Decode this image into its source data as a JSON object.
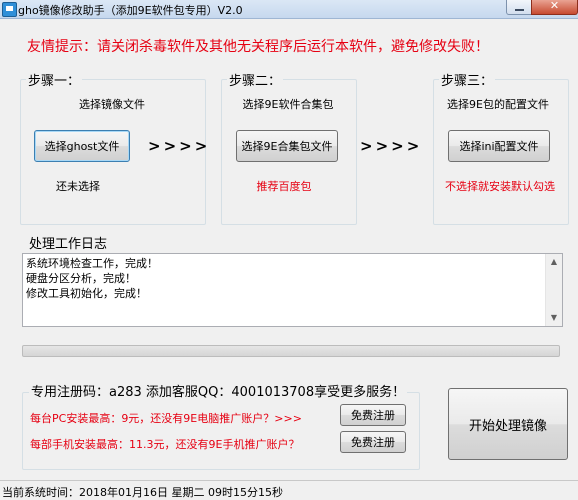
{
  "window": {
    "title": "gho镜像修改助手（添加9E软件包专用）V2.0"
  },
  "notice": "友情提示：请关闭杀毒软件及其他无关程序后运行本软件，避免修改失败！",
  "steps": [
    {
      "title": "步骤一：",
      "desc": "选择镜像文件",
      "button": "选择ghost文件",
      "status": "还未选择",
      "status_color": "#000000"
    },
    {
      "title": "步骤二：",
      "desc": "选择9E软件合集包",
      "button": "选择9E合集包文件",
      "status": "推荐百度包",
      "status_color": "#e60012"
    },
    {
      "title": "步骤三：",
      "desc": "选择9E包的配置文件",
      "button": "选择ini配置文件",
      "status": "不选择就安装默认勾选",
      "status_color": "#e60012"
    }
  ],
  "arrows": ">>>>",
  "log": {
    "title": "处理工作日志",
    "lines": [
      "系统环境检查工作，完成！",
      "硬盘分区分析，完成！",
      "修改工具初始化，完成！"
    ]
  },
  "progress": {
    "value": 0
  },
  "registration": {
    "heading": "专用注册码：a283  添加客服QQ：4001013708享受更多服务！",
    "promo_pc": "每台PC安装最高：9元，还没有9E电脑推广账户？>>>",
    "promo_mobile": "每部手机安装最高：11.3元，还没有9E手机推广账户？",
    "register_label": "免费注册"
  },
  "start_button": "开始处理镜像",
  "status_bar": "当前系统时间：2018年01月16日 星期二 09时15分15秒"
}
